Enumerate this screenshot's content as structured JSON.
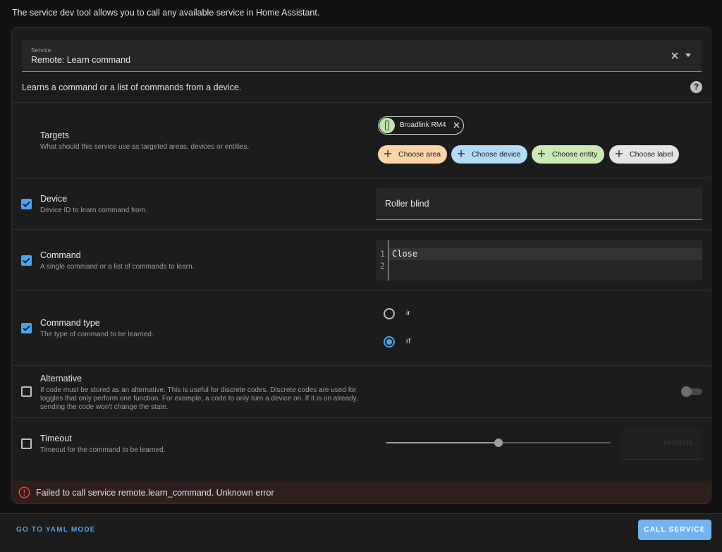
{
  "intro": "The service dev tool allows you to call any available service in Home Assistant.",
  "service": {
    "label": "Service",
    "value": "Remote: Learn command",
    "description": "Learns a command or a list of commands from a device."
  },
  "targets": {
    "title": "Targets",
    "subtitle": "What should this service use as targeted areas, devices or entities.",
    "selected_entity": "Broadlink RM4",
    "choose_area": "Choose area",
    "choose_device": "Choose device",
    "choose_entity": "Choose entity",
    "choose_label": "Choose label"
  },
  "device": {
    "title": "Device",
    "subtitle": "Device ID to learn command from.",
    "value": "Roller blind",
    "checked": true
  },
  "command": {
    "title": "Command",
    "subtitle": "A single command or a list of commands to learn.",
    "line1": "1",
    "line2": "2",
    "code": "Close",
    "checked": true
  },
  "command_type": {
    "title": "Command type",
    "subtitle": "The type of command to be learned.",
    "options": [
      "ir",
      "rf"
    ],
    "selected": "rf",
    "checked": true
  },
  "alternative": {
    "title": "Alternative",
    "subtitle_l1": "If code must be stored as an alternative. This is useful for discrete codes. Discrete codes are used for",
    "subtitle_l2": "toggles that only perform one function. For example, a code to only turn a device on. If it is on already,",
    "subtitle_l3": "sending the code won't change the state.",
    "checked": false,
    "toggle_on": false
  },
  "timeout": {
    "title": "Timeout",
    "subtitle": "Timeout for the command to be learned.",
    "suffix": "seconds",
    "checked": false,
    "slider_fraction": 0.5
  },
  "error": {
    "message": "Failed to call service remote.learn_command. Unknown error"
  },
  "footer": {
    "yaml_mode": "GO TO YAML MODE",
    "call_service": "CALL SERVICE"
  },
  "colors": {
    "accent": "#4aa3f0",
    "area_chip": "#fcd4a8",
    "device_chip": "#b3dcf7",
    "entity_chip": "#cbe9b5",
    "label_chip": "#e4e4e4",
    "error": "#e0493e"
  }
}
